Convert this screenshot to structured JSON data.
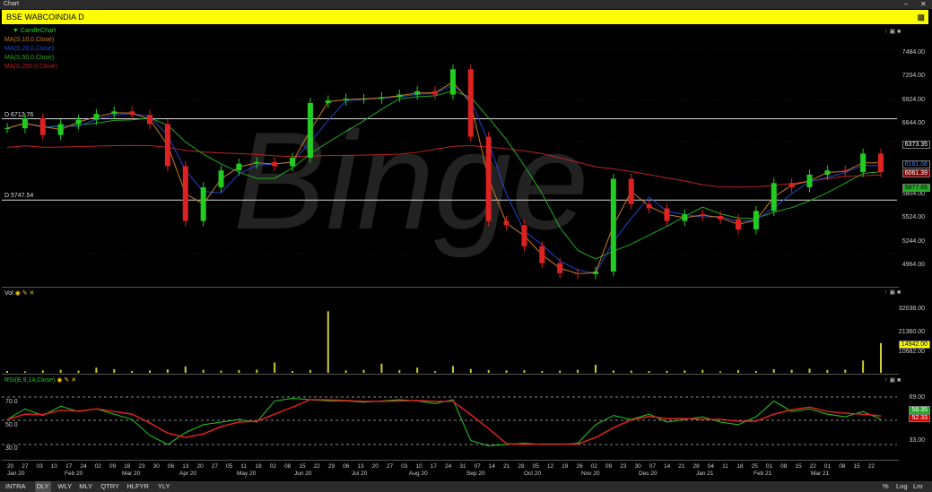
{
  "window": {
    "title": "Chart"
  },
  "symbol": {
    "label": "BSE WABCOINDIA D"
  },
  "price_pane": {
    "legend": [
      {
        "label": "CandleChart",
        "color": "#22cc22"
      },
      {
        "label": "MA(S,10,0,Close)",
        "color": "#cc7a22"
      },
      {
        "label": "MA(S,20,0,Close)",
        "color": "#2244cc"
      },
      {
        "label": "MA(S,50,0,Close)",
        "color": "#22aa22"
      },
      {
        "label": "MA(S,200,0,Close)",
        "color": "#bb2222"
      }
    ],
    "hlines": [
      {
        "label": "D 6712.76",
        "value": 6712.76
      },
      {
        "label": "D 5747.54",
        "value": 5747.54
      }
    ],
    "y_ticks": [
      "7484.00",
      "7204.00",
      "6924.00",
      "6644.00",
      "5804.00",
      "5524.00",
      "5244.00",
      "4964.00"
    ],
    "tags": [
      {
        "label": "6373.35",
        "bg": "#000000",
        "fg": "#ffffff"
      },
      {
        "label": "6161.08",
        "bg": "#000000",
        "fg": "#4a7dff"
      },
      {
        "label": "6061.39",
        "bg": "#880000",
        "fg": "#ffffff"
      },
      {
        "label": "5877.65",
        "bg": "#22aa22",
        "fg": "#000000"
      }
    ],
    "watermark": "Binge"
  },
  "vol_pane": {
    "label": "Vol",
    "y_ticks": [
      "32038.00",
      "21360.00",
      "10682.00"
    ],
    "tag": "14942.00"
  },
  "rsi_pane": {
    "label": "RSI(E,9,14,Close)",
    "left_ticks": [
      "70.0",
      "50.0",
      "30.0"
    ],
    "right_ticks": [
      "69.00",
      "33.00"
    ],
    "tags": [
      {
        "label": "58.35",
        "bg": "#22aa22"
      },
      {
        "label": "52.33",
        "bg": "#cc0000"
      }
    ]
  },
  "x_days": [
    "20",
    "27",
    "03",
    "10",
    "17",
    "24",
    "02",
    "09",
    "16",
    "23",
    "30",
    "06",
    "13",
    "20",
    "27",
    "05",
    "11",
    "18",
    "02",
    "08",
    "15",
    "22",
    "29",
    "06",
    "13",
    "20",
    "27",
    "03",
    "10",
    "17",
    "24",
    "31",
    "07",
    "14",
    "21",
    "28",
    "05",
    "12",
    "19",
    "26",
    "02",
    "09",
    "23",
    "30",
    "07",
    "14",
    "21",
    "28",
    "04",
    "11",
    "18",
    "25",
    "01",
    "08",
    "15",
    "22",
    "01",
    "08",
    "15",
    "22"
  ],
  "x_months": [
    "Jan 20",
    "Feb 20",
    "Mar 20",
    "Apr 20",
    "May 20",
    "Jun 20",
    "Jul 20",
    "Aug 20",
    "Sep 20",
    "Oct 20",
    "Nov 20",
    "Dec 20",
    "Jan 21",
    "Feb 21",
    "Mar 21"
  ],
  "tabs": [
    "INTRA",
    "DLY",
    "WLY",
    "MLY",
    "QTRY",
    "HLFYR",
    "YLY"
  ],
  "active_tab": "DLY",
  "bottom_right": [
    "%",
    "Log",
    "Lnr"
  ],
  "chart_data": {
    "type": "candlestick",
    "price_series": [
      6600,
      6720,
      6520,
      6650,
      6700,
      6770,
      6800,
      6760,
      6650,
      6150,
      5500,
      5900,
      6100,
      6180,
      6200,
      6150,
      6250,
      6900,
      6930,
      6950,
      6950,
      6970,
      7000,
      7040,
      7000,
      7300,
      6500,
      5500,
      5450,
      5200,
      5000,
      4880,
      4870,
      4900,
      6000,
      5700,
      5650,
      5500,
      5580,
      5560,
      5520,
      5400,
      5620,
      5950,
      5900,
      6050,
      6100,
      6080,
      6300,
      6080
    ]
  }
}
